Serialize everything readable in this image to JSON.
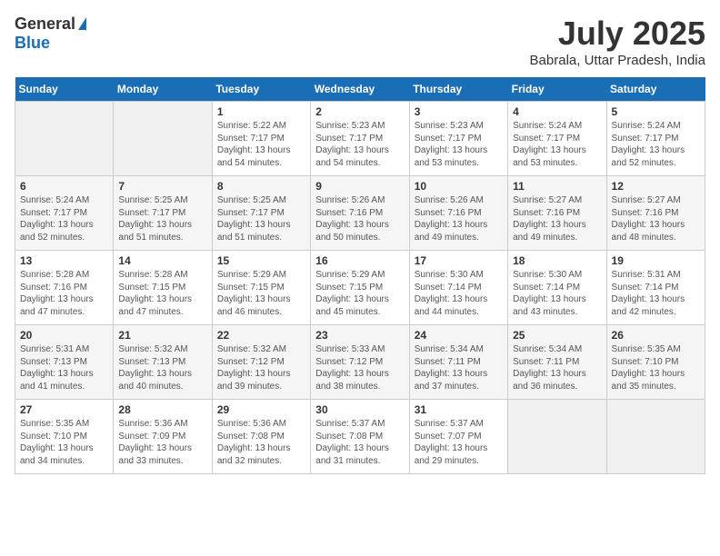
{
  "header": {
    "logo_general": "General",
    "logo_blue": "Blue",
    "month_title": "July 2025",
    "location": "Babrala, Uttar Pradesh, India"
  },
  "days_of_week": [
    "Sunday",
    "Monday",
    "Tuesday",
    "Wednesday",
    "Thursday",
    "Friday",
    "Saturday"
  ],
  "weeks": [
    [
      {
        "day": "",
        "detail": ""
      },
      {
        "day": "",
        "detail": ""
      },
      {
        "day": "1",
        "detail": "Sunrise: 5:22 AM\nSunset: 7:17 PM\nDaylight: 13 hours and 54 minutes."
      },
      {
        "day": "2",
        "detail": "Sunrise: 5:23 AM\nSunset: 7:17 PM\nDaylight: 13 hours and 54 minutes."
      },
      {
        "day": "3",
        "detail": "Sunrise: 5:23 AM\nSunset: 7:17 PM\nDaylight: 13 hours and 53 minutes."
      },
      {
        "day": "4",
        "detail": "Sunrise: 5:24 AM\nSunset: 7:17 PM\nDaylight: 13 hours and 53 minutes."
      },
      {
        "day": "5",
        "detail": "Sunrise: 5:24 AM\nSunset: 7:17 PM\nDaylight: 13 hours and 52 minutes."
      }
    ],
    [
      {
        "day": "6",
        "detail": "Sunrise: 5:24 AM\nSunset: 7:17 PM\nDaylight: 13 hours and 52 minutes."
      },
      {
        "day": "7",
        "detail": "Sunrise: 5:25 AM\nSunset: 7:17 PM\nDaylight: 13 hours and 51 minutes."
      },
      {
        "day": "8",
        "detail": "Sunrise: 5:25 AM\nSunset: 7:17 PM\nDaylight: 13 hours and 51 minutes."
      },
      {
        "day": "9",
        "detail": "Sunrise: 5:26 AM\nSunset: 7:16 PM\nDaylight: 13 hours and 50 minutes."
      },
      {
        "day": "10",
        "detail": "Sunrise: 5:26 AM\nSunset: 7:16 PM\nDaylight: 13 hours and 49 minutes."
      },
      {
        "day": "11",
        "detail": "Sunrise: 5:27 AM\nSunset: 7:16 PM\nDaylight: 13 hours and 49 minutes."
      },
      {
        "day": "12",
        "detail": "Sunrise: 5:27 AM\nSunset: 7:16 PM\nDaylight: 13 hours and 48 minutes."
      }
    ],
    [
      {
        "day": "13",
        "detail": "Sunrise: 5:28 AM\nSunset: 7:16 PM\nDaylight: 13 hours and 47 minutes."
      },
      {
        "day": "14",
        "detail": "Sunrise: 5:28 AM\nSunset: 7:15 PM\nDaylight: 13 hours and 47 minutes."
      },
      {
        "day": "15",
        "detail": "Sunrise: 5:29 AM\nSunset: 7:15 PM\nDaylight: 13 hours and 46 minutes."
      },
      {
        "day": "16",
        "detail": "Sunrise: 5:29 AM\nSunset: 7:15 PM\nDaylight: 13 hours and 45 minutes."
      },
      {
        "day": "17",
        "detail": "Sunrise: 5:30 AM\nSunset: 7:14 PM\nDaylight: 13 hours and 44 minutes."
      },
      {
        "day": "18",
        "detail": "Sunrise: 5:30 AM\nSunset: 7:14 PM\nDaylight: 13 hours and 43 minutes."
      },
      {
        "day": "19",
        "detail": "Sunrise: 5:31 AM\nSunset: 7:14 PM\nDaylight: 13 hours and 42 minutes."
      }
    ],
    [
      {
        "day": "20",
        "detail": "Sunrise: 5:31 AM\nSunset: 7:13 PM\nDaylight: 13 hours and 41 minutes."
      },
      {
        "day": "21",
        "detail": "Sunrise: 5:32 AM\nSunset: 7:13 PM\nDaylight: 13 hours and 40 minutes."
      },
      {
        "day": "22",
        "detail": "Sunrise: 5:32 AM\nSunset: 7:12 PM\nDaylight: 13 hours and 39 minutes."
      },
      {
        "day": "23",
        "detail": "Sunrise: 5:33 AM\nSunset: 7:12 PM\nDaylight: 13 hours and 38 minutes."
      },
      {
        "day": "24",
        "detail": "Sunrise: 5:34 AM\nSunset: 7:11 PM\nDaylight: 13 hours and 37 minutes."
      },
      {
        "day": "25",
        "detail": "Sunrise: 5:34 AM\nSunset: 7:11 PM\nDaylight: 13 hours and 36 minutes."
      },
      {
        "day": "26",
        "detail": "Sunrise: 5:35 AM\nSunset: 7:10 PM\nDaylight: 13 hours and 35 minutes."
      }
    ],
    [
      {
        "day": "27",
        "detail": "Sunrise: 5:35 AM\nSunset: 7:10 PM\nDaylight: 13 hours and 34 minutes."
      },
      {
        "day": "28",
        "detail": "Sunrise: 5:36 AM\nSunset: 7:09 PM\nDaylight: 13 hours and 33 minutes."
      },
      {
        "day": "29",
        "detail": "Sunrise: 5:36 AM\nSunset: 7:08 PM\nDaylight: 13 hours and 32 minutes."
      },
      {
        "day": "30",
        "detail": "Sunrise: 5:37 AM\nSunset: 7:08 PM\nDaylight: 13 hours and 31 minutes."
      },
      {
        "day": "31",
        "detail": "Sunrise: 5:37 AM\nSunset: 7:07 PM\nDaylight: 13 hours and 29 minutes."
      },
      {
        "day": "",
        "detail": ""
      },
      {
        "day": "",
        "detail": ""
      }
    ]
  ]
}
